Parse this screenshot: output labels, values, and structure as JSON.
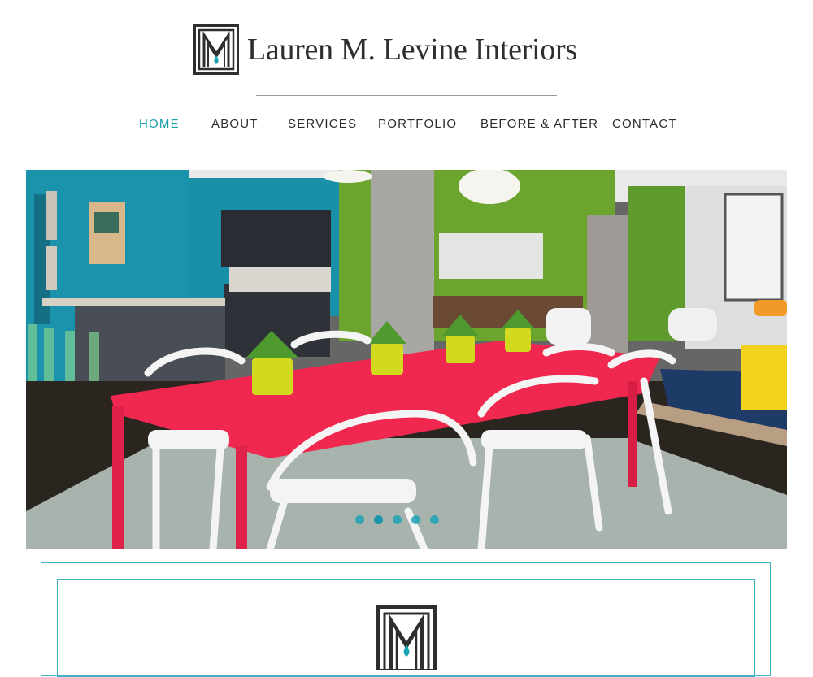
{
  "brand": {
    "name": "Lauren M. Levine Interiors"
  },
  "nav": {
    "items": [
      {
        "label": "HOME",
        "active": true
      },
      {
        "label": "ABOUT",
        "active": false
      },
      {
        "label": "SERVICES",
        "active": false
      },
      {
        "label": "PORTFOLIO",
        "active": false
      },
      {
        "label": "BEFORE & AFTER",
        "active": false
      },
      {
        "label": "CONTACT",
        "active": false
      }
    ]
  },
  "slider": {
    "slide_count": 5,
    "active_slide": 1
  },
  "colors": {
    "accent": "#16a0ac",
    "nav_text": "#2b2b2b",
    "brand_text": "#2e2e2e",
    "panel_border": "#3fb3c4",
    "logo_drop": "#1aa3b3"
  }
}
